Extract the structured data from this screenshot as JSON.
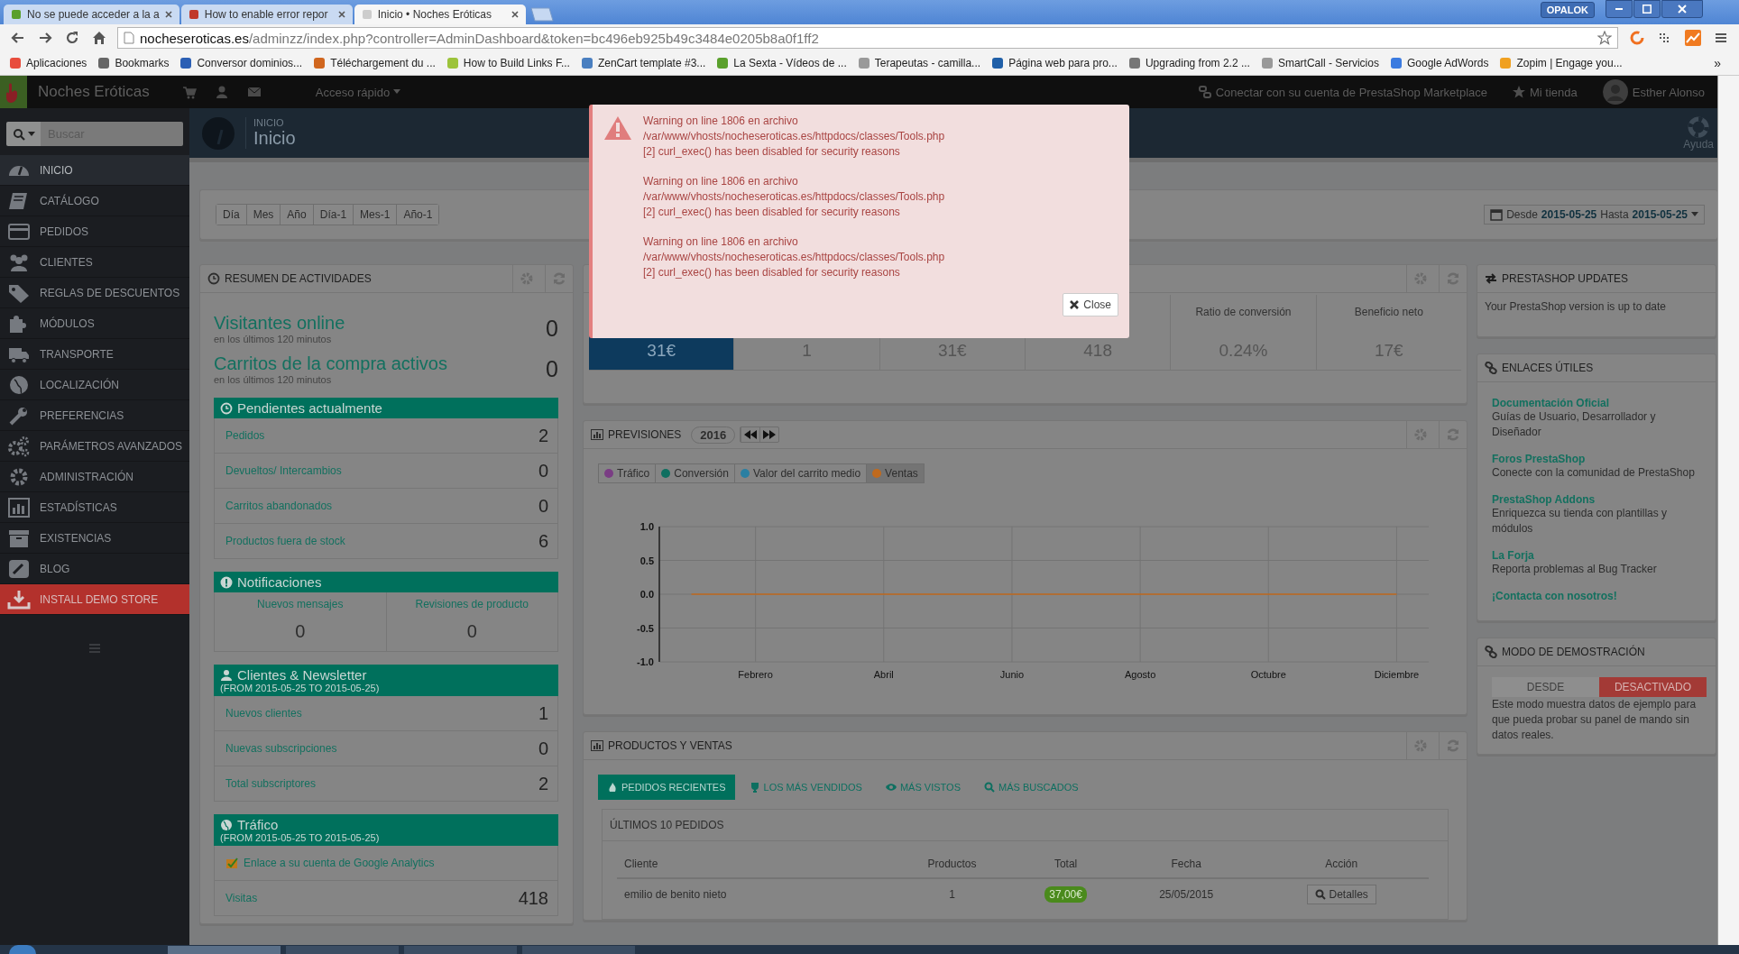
{
  "browser": {
    "tabs": [
      {
        "title": "No se puede acceder a la a",
        "selected": false
      },
      {
        "title": "How to enable error repor",
        "selected": false
      },
      {
        "title": "Inicio • Noches Eróticas",
        "selected": true
      }
    ],
    "profile": "OPALOK",
    "url_host": "nocheseroticas.es",
    "url_path": "/adminzz/index.php?controller=AdminDashboard&token=bc496eb925b49c3484e0205b8a0f1ff2",
    "bookmarks": [
      "Aplicaciones",
      "Bookmarks",
      "Conversor dominios...",
      "Téléchargement du ...",
      "How to Build Links F...",
      "ZenCart template #3...",
      "La Sexta - Vídeos de ...",
      "Terapeutas - camilla...",
      "Página web para pro...",
      "Upgrading from 2.2 ...",
      "SmartCall - Servicios",
      "Google AdWords",
      "Zopim | Engage you..."
    ],
    "bookmarks_more": "»"
  },
  "admin_header": {
    "shop_name": "Noches Eróticas",
    "quick_access": "Acceso rápido",
    "marketplace": "Conectar con su cuenta de PrestaShop Marketplace",
    "my_shop": "Mi tienda",
    "employee": "Esther Alonso"
  },
  "sidebar": {
    "search_placeholder": "Buscar",
    "items": [
      {
        "label": "INICIO",
        "selected": true,
        "kind": "menu"
      },
      {
        "label": "CATÁLOGO",
        "selected": false,
        "kind": "menu"
      },
      {
        "label": "PEDIDOS",
        "selected": false,
        "kind": "menu"
      },
      {
        "label": "CLIENTES",
        "selected": false,
        "kind": "menu"
      },
      {
        "label": "REGLAS DE DESCUENTOS",
        "selected": false,
        "kind": "menu"
      },
      {
        "label": "MÓDULOS",
        "selected": false,
        "kind": "menu"
      },
      {
        "label": "TRANSPORTE",
        "selected": false,
        "kind": "menu"
      },
      {
        "label": "LOCALIZACIÓN",
        "selected": false,
        "kind": "menu"
      },
      {
        "label": "PREFERENCIAS",
        "selected": false,
        "kind": "menu"
      },
      {
        "label": "PARÁMETROS AVANZADOS",
        "selected": false,
        "kind": "menu"
      },
      {
        "label": "ADMINISTRACIÓN",
        "selected": false,
        "kind": "menu"
      },
      {
        "label": "ESTADÍSTICAS",
        "selected": false,
        "kind": "menu"
      },
      {
        "label": "EXISTENCIAS",
        "selected": false,
        "kind": "menu"
      },
      {
        "label": "BLOG",
        "selected": false,
        "kind": "menu"
      },
      {
        "label": "INSTALL DEMO STORE",
        "selected": false,
        "kind": "action"
      }
    ]
  },
  "page_header": {
    "breadcrumb": "INICIO",
    "title": "Inicio",
    "help": "Ayuda"
  },
  "date_range": {
    "presets": [
      "Día",
      "Mes",
      "Año",
      "Día-1",
      "Mes-1",
      "Año-1"
    ],
    "from_label": "Desde",
    "from": "2015-05-25",
    "to_label": "Hasta",
    "to": "2015-05-25"
  },
  "activity": {
    "title": "RESUMEN DE ACTIVIDADES",
    "stats": [
      {
        "label": "Visitantes online",
        "sublabel": "en los últimos 120 minutos",
        "value": "0"
      },
      {
        "label": "Carritos de la compra activos",
        "sublabel": "en los últimos 120 minutos",
        "value": "0"
      }
    ],
    "sections": [
      {
        "title": "Pendientes actualmente",
        "kind": "list",
        "rows": [
          {
            "label": "Pedidos",
            "value": "2"
          },
          {
            "label": "Devueltos/ Intercambios",
            "value": "0"
          },
          {
            "label": "Carritos abandonados",
            "value": "0"
          },
          {
            "label": "Productos fuera de stock",
            "value": "6"
          }
        ]
      },
      {
        "title": "Notificaciones",
        "kind": "columns",
        "rows": [
          {
            "label": "Nuevos mensajes",
            "value": "0"
          },
          {
            "label": "Revisiones de producto",
            "value": "0"
          }
        ]
      },
      {
        "title": "Clientes & Newsletter",
        "subtitle": "(FROM 2015-05-25 TO 2015-05-25)",
        "kind": "list",
        "rows": [
          {
            "label": "Nuevos clientes",
            "value": "1"
          },
          {
            "label": "Nuevas subscripciones",
            "value": "0"
          },
          {
            "label": "Total subscriptores",
            "value": "2"
          }
        ]
      },
      {
        "title": "Tráfico",
        "subtitle": "(FROM 2015-05-25 TO 2015-05-25)",
        "kind": "list",
        "rows": [
          {
            "label": "Enlace a su cuenta de Google Analytics",
            "kind": "link"
          },
          {
            "label": "Visitas",
            "value": "418",
            "kind": "stat"
          }
        ]
      }
    ]
  },
  "kpis": [
    {
      "value": "31€",
      "selected": true
    },
    {
      "value": "1",
      "selected": false
    },
    {
      "value": "31€",
      "selected": false
    },
    {
      "value": "418",
      "selected": false
    },
    {
      "label": "Ratio de conversión",
      "value": "0.24%",
      "selected": false
    },
    {
      "label": "Beneficio neto",
      "value": "17€",
      "selected": false
    }
  ],
  "forecast": {
    "title": "PREVISIONES",
    "year": "2016",
    "legend": [
      {
        "selected": false
      },
      {
        "selected": false
      },
      {
        "selected": false
      },
      {
        "selected": true
      }
    ],
    "chart_data": {
      "type": "line",
      "categories": [
        null,
        "Febrero",
        null,
        "Abril",
        null,
        "Junio",
        null,
        "Agosto",
        null,
        "Octubre",
        null,
        "Diciembre"
      ],
      "series": [
        {
          "name": "Tráfico",
          "color": "#7a3d84",
          "values": [
            null,
            null,
            null,
            null,
            null,
            null,
            null,
            null,
            null,
            null,
            null,
            null
          ]
        },
        {
          "name": "Conversión",
          "color": "#0f6f60",
          "values": [
            null,
            null,
            null,
            null,
            null,
            null,
            null,
            null,
            null,
            null,
            null,
            null
          ]
        },
        {
          "name": "Valor del carrito medio",
          "color": "#2a7fa2",
          "values": [
            null,
            null,
            null,
            null,
            null,
            null,
            null,
            null,
            null,
            null,
            null,
            null
          ]
        },
        {
          "name": "Ventas",
          "color": "#c06a1e",
          "values": [
            0,
            0,
            0,
            0,
            0,
            0,
            0,
            0,
            0,
            0,
            0,
            0
          ]
        }
      ],
      "ylim": [
        -1,
        1
      ],
      "grid": true,
      "yticks": [
        {
          "value": 1,
          "label": "1.0"
        },
        {
          "value": 0.5,
          "label": "0.5"
        },
        {
          "value": 0,
          "label": "0.0"
        },
        {
          "value": -0.5,
          "label": "-0.5"
        },
        {
          "value": -1,
          "label": "-1.0"
        }
      ]
    }
  },
  "products": {
    "title": "PRODUCTOS Y VENTAS",
    "tabs": [
      {
        "label": "PEDIDOS RECIENTES",
        "selected": true
      },
      {
        "label": "LOS MÁS VENDIDOS",
        "selected": false
      },
      {
        "label": "MÁS VISTOS",
        "selected": false
      },
      {
        "label": "MÁS BUSCADOS",
        "selected": false
      }
    ],
    "table": {
      "title": "ÚLTIMOS 10 PEDIDOS",
      "columns": [
        "Cliente",
        "Productos",
        "Total",
        "Fecha",
        "Acción"
      ],
      "rows": [
        {
          "cliente": "emilio de benito nieto",
          "productos": "1",
          "total": "37,00€",
          "fecha": "25/05/2015",
          "action": "Detalles"
        }
      ]
    }
  },
  "updates": {
    "title": "PRESTASHOP UPDATES",
    "text": "Your PrestaShop version is up to date"
  },
  "links": {
    "title": "ENLACES ÚTILES",
    "items": [
      {
        "title": "Documentación Oficial",
        "description": "Guías de Usuario, Desarrollador y Diseñador"
      },
      {
        "title": "Foros PrestaShop",
        "description": "Conecte con la comunidad de PrestaShop"
      },
      {
        "title": "PrestaShop Addons",
        "description": "Enriquezca su tienda con plantillas y módulos"
      },
      {
        "title": "La Forja",
        "description": "Reporta problemas al Bug Tracker"
      }
    ],
    "contact": "¡Contacta con nosotros!"
  },
  "demo_mode": {
    "title": "MODO DE DEMOSTRACIÓN",
    "options": [
      {
        "label": "DESDE",
        "selected": false
      },
      {
        "label": "DESACTIVADO",
        "selected": true
      }
    ],
    "description": "Este modo muestra datos de ejemplo para que pueda probar su panel de mando sin datos reales."
  },
  "alert": {
    "messages": [
      {
        "lines": [
          "Warning on line 1806 en archivo",
          "/var/www/vhosts/nocheseroticas.es/httpdocs/classes/Tools.php",
          "[2] curl_exec() has been disabled for security reasons"
        ]
      },
      {
        "lines": [
          "Warning on line 1806 en archivo",
          "/var/www/vhosts/nocheseroticas.es/httpdocs/classes/Tools.php",
          "[2] curl_exec() has been disabled for security reasons"
        ]
      },
      {
        "lines": [
          "Warning on line 1806 en archivo",
          "/var/www/vhosts/nocheseroticas.es/httpdocs/classes/Tools.php",
          "[2] curl_exec() has been disabled for security reasons"
        ]
      }
    ],
    "close": "Close"
  }
}
